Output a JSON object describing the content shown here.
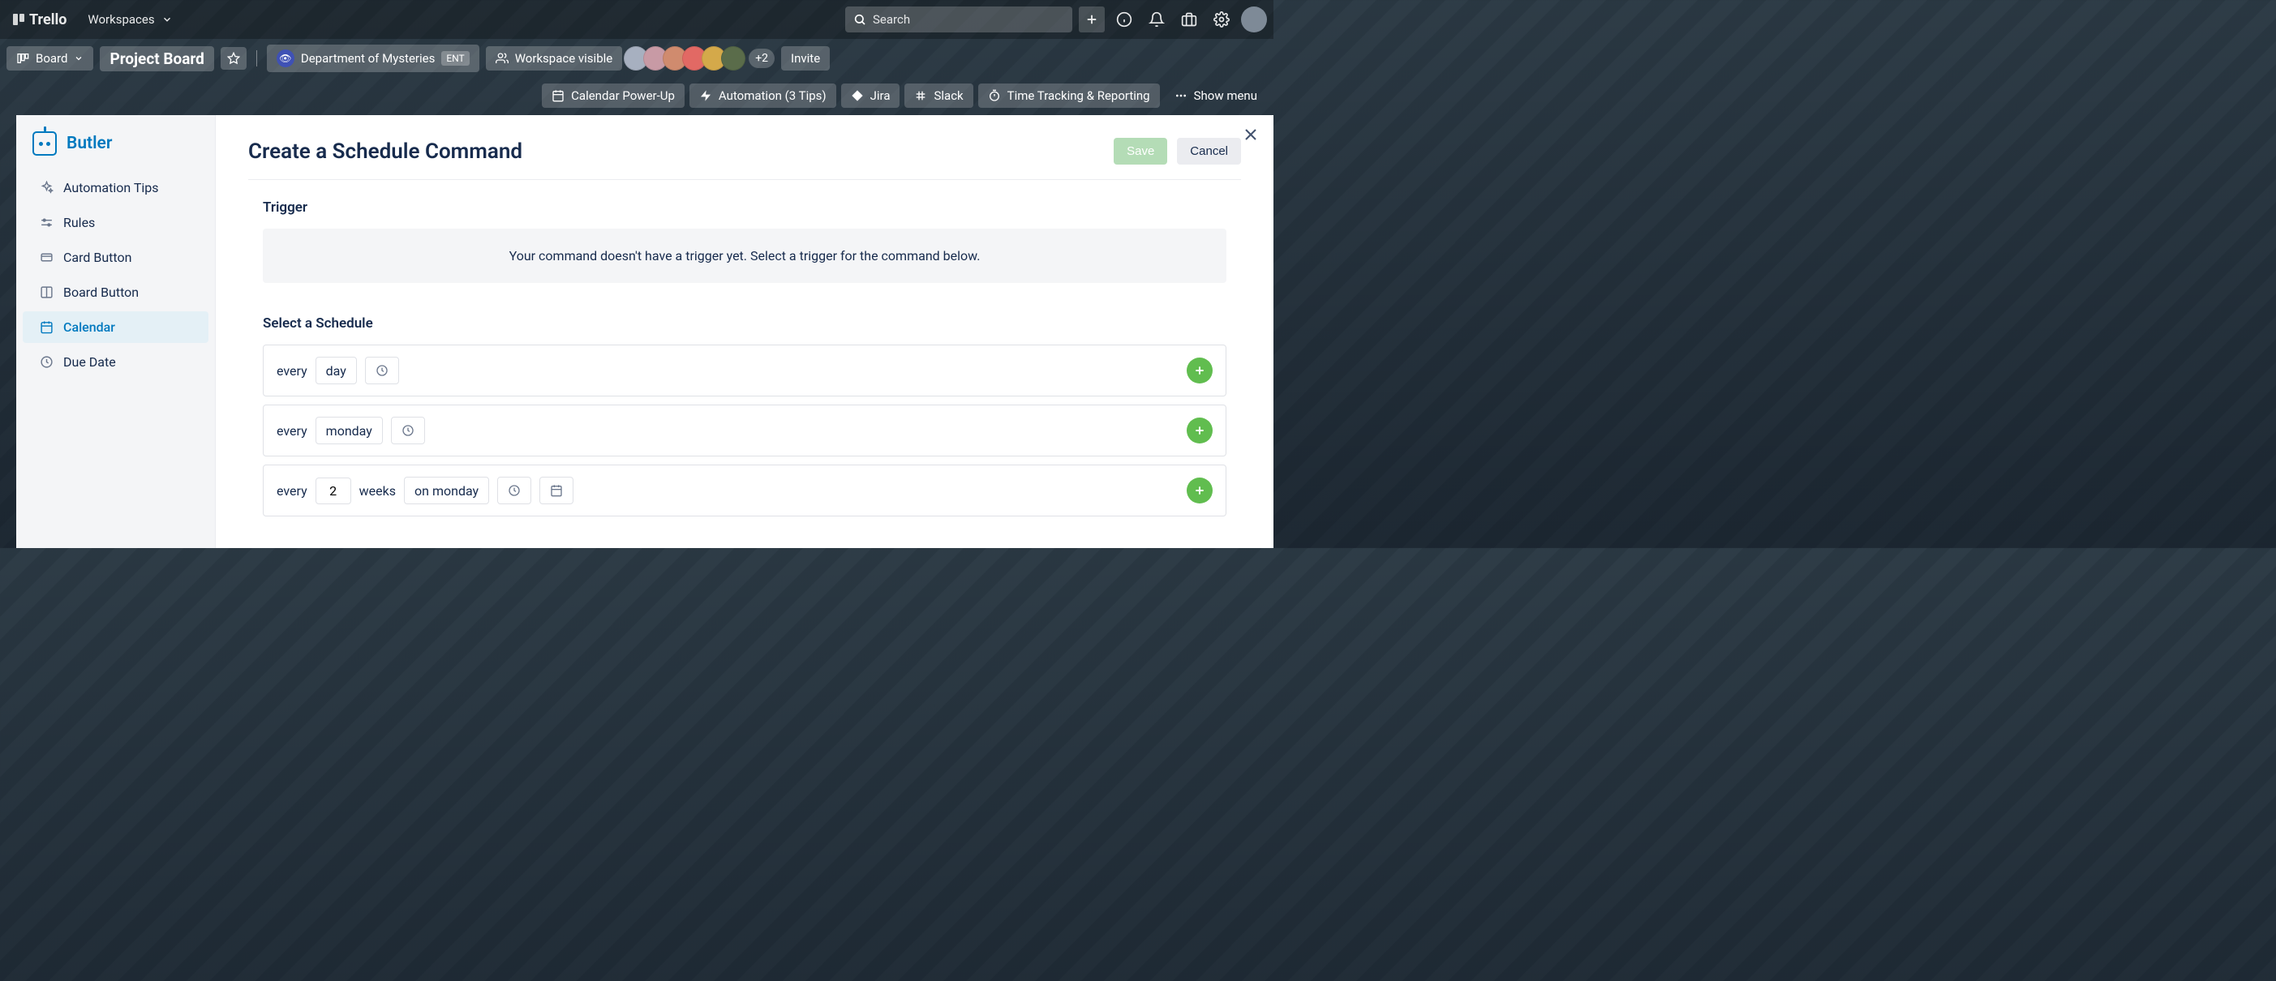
{
  "topbar": {
    "brand": "Trello",
    "workspaces": "Workspaces",
    "search_placeholder": "Search"
  },
  "boardbar": {
    "board_btn": "Board",
    "board_name": "Project Board",
    "team_name": "Department of Mysteries",
    "team_badge": "ENT",
    "workspace_visible": "Workspace visible",
    "member_overflow": "+2",
    "invite": "Invite"
  },
  "secondary": {
    "calendar_pu": "Calendar Power-Up",
    "automation": "Automation (3 Tips)",
    "jira": "Jira",
    "slack": "Slack",
    "time_tracking": "Time Tracking & Reporting",
    "show_menu": "Show menu"
  },
  "sidebar": {
    "title": "Butler",
    "items": [
      {
        "label": "Automation Tips"
      },
      {
        "label": "Rules"
      },
      {
        "label": "Card Button"
      },
      {
        "label": "Board Button"
      },
      {
        "label": "Calendar"
      },
      {
        "label": "Due Date"
      }
    ]
  },
  "main": {
    "title": "Create a Schedule Command",
    "save": "Save",
    "cancel": "Cancel",
    "trigger_heading": "Trigger",
    "trigger_empty": "Your command doesn't have a trigger yet. Select a trigger for the command below.",
    "select_heading": "Select a Schedule",
    "rows": {
      "every": "every",
      "weeks": "weeks",
      "r1_val": "day",
      "r2_val": "monday",
      "r3_num": "2",
      "r3_val": "on monday"
    }
  }
}
